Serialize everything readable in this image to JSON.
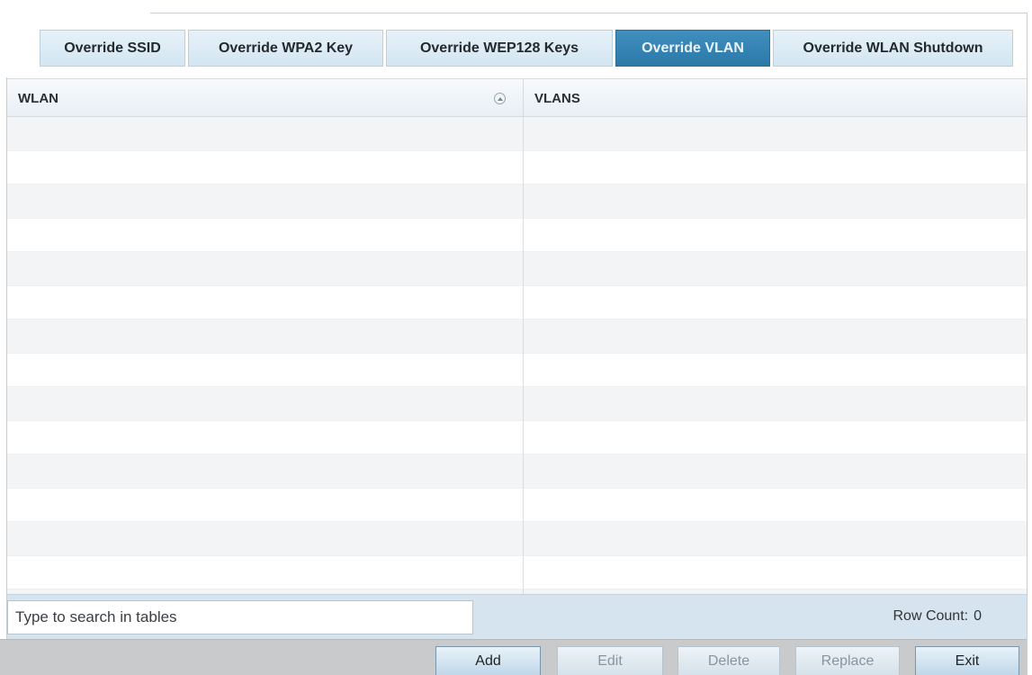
{
  "tabs": [
    {
      "label": "Override SSID",
      "active": false
    },
    {
      "label": "Override WPA2 Key",
      "active": false
    },
    {
      "label": "Override WEP128 Keys",
      "active": false
    },
    {
      "label": "Override VLAN",
      "active": true
    },
    {
      "label": "Override WLAN Shutdown",
      "active": false
    }
  ],
  "table": {
    "columns": [
      "WLAN",
      "VLANS"
    ],
    "sort_icon": "sort-ascending-icon",
    "rows": []
  },
  "search": {
    "placeholder": "Type to search in tables"
  },
  "row_count": {
    "label": "Row Count:",
    "value": "0"
  },
  "buttons": {
    "add": "Add",
    "edit": "Edit",
    "delete": "Delete",
    "replace": "Replace",
    "exit": "Exit"
  },
  "colors": {
    "tab_active": "#2c79a8",
    "tab_inactive": "#d3e6f2",
    "footer_band": "#d6e4ef",
    "button_bar": "#c9cacb"
  }
}
